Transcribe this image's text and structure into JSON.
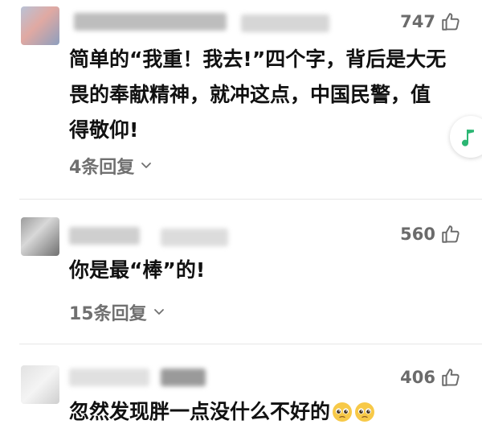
{
  "comments": [
    {
      "likes": "747",
      "text": "简单的“我重！我去!”四个字，背后是大无畏的奉献精神，就冲这点，中国民警，值得敬仰!",
      "replies": "4条回复"
    },
    {
      "likes": "560",
      "text": "你是最“棒”的!",
      "replies": "15条回复"
    },
    {
      "likes": "406",
      "text": "忽然发现胖一点没什么不好的"
    }
  ],
  "icons": {
    "like": "thumbs-up-outline-icon",
    "expand": "chevron-down-icon",
    "music": "music-note-icon",
    "emoji": "pleading-face-emoji"
  },
  "colors": {
    "text": "#111111",
    "meta": "#707070",
    "music_note": "#2bb673",
    "divider": "#e6e6e6"
  }
}
